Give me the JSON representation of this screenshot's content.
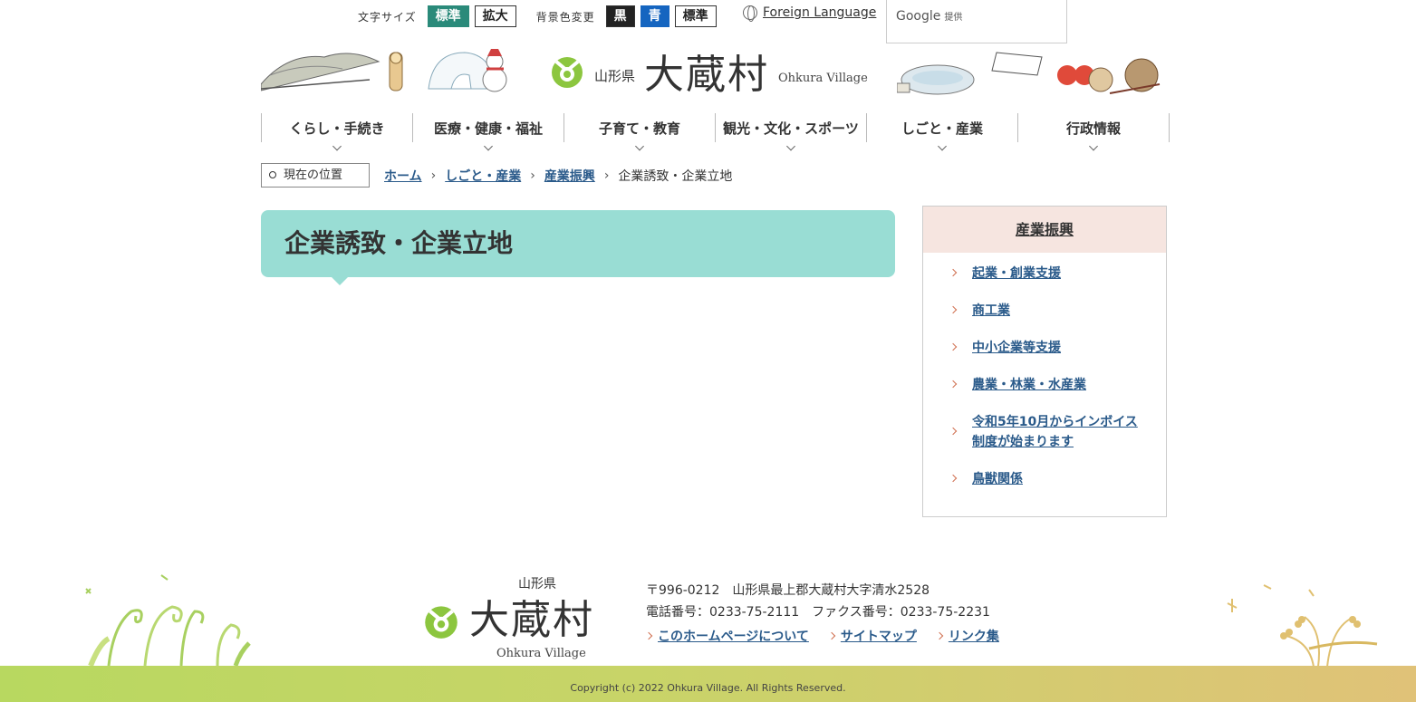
{
  "topbar": {
    "font_size_label": "文字サイズ",
    "font_standard": "標準",
    "font_large": "拡大",
    "bg_label": "背景色変更",
    "bg_black": "黒",
    "bg_blue": "青",
    "bg_standard": "標準",
    "foreign_language": "Foreign Language"
  },
  "google": {
    "brand": "Google",
    "provided": "提供"
  },
  "header": {
    "prefecture": "山形県",
    "village_name": "大蔵村",
    "village_en": "Ohkura Village"
  },
  "nav": {
    "items": [
      "くらし・手続き",
      "医療・健康・福祉",
      "子育て・教育",
      "観光・文化・スポーツ",
      "しごと・産業",
      "行政情報"
    ]
  },
  "breadcrumb": {
    "label": "現在の位置",
    "links": [
      "ホーム",
      "しごと・産業",
      "産業振興"
    ],
    "current": "企業誘致・企業立地"
  },
  "page": {
    "title": "企業誘致・企業立地"
  },
  "sidebar": {
    "heading": "産業振興",
    "items": [
      "起業・創業支援",
      "商工業",
      "中小企業等支援",
      "農業・林業・水産業",
      "令和5年10月からインボイス制度が始まります",
      "鳥獣関係"
    ]
  },
  "footer": {
    "prefecture": "山形県",
    "village_name": "大蔵村",
    "village_en": "Ohkura Village",
    "address": "〒996-0212　山形県最上郡大蔵村大字清水2528",
    "phone": "電話番号：0233-75-2111　ファクス番号：0233-75-2231",
    "links": [
      "このホームページについて",
      "サイトマップ",
      "リンク集"
    ],
    "copyright": "Copyright (c) 2022 Ohkura Village. All Rights Reserved."
  },
  "colors": {
    "accent_teal": "#2a8a7a",
    "title_bg": "#99ddd4",
    "sidebar_head_bg": "#f6e5e0",
    "link": "#2a5a8a",
    "arrow": "#d07050"
  }
}
